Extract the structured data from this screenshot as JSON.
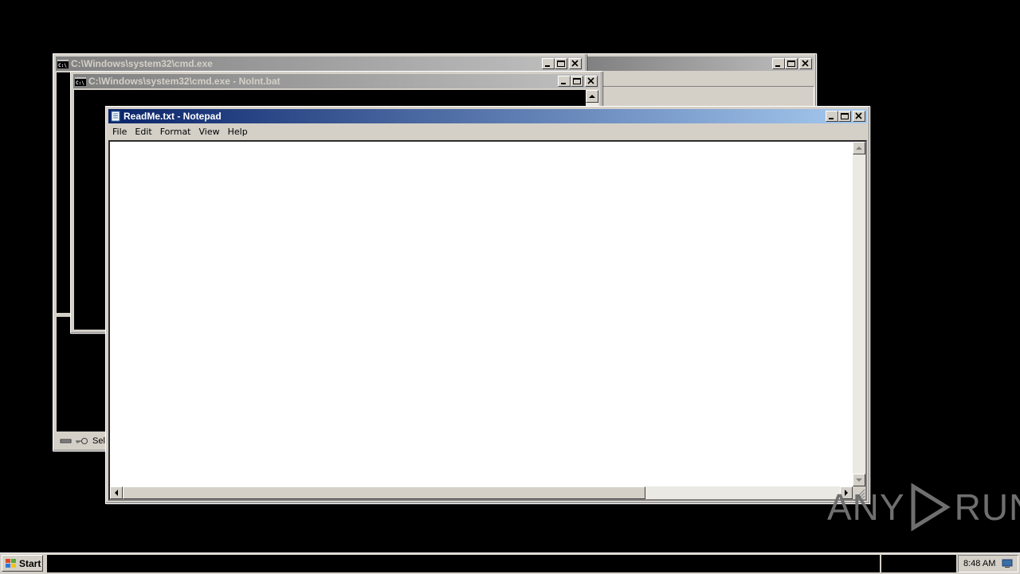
{
  "windows": {
    "cmd1": {
      "title": "C:\\Windows\\system32\\cmd.exe"
    },
    "cmd2": {
      "title": "C:\\Windows\\system32\\cmd.exe - NoInt.bat"
    },
    "notepad": {
      "title": "ReadMe.txt - Notepad",
      "menu": [
        "File",
        "Edit",
        "Format",
        "View",
        "Help"
      ],
      "content": ""
    }
  },
  "cmd_status": {
    "select_text": "Sele"
  },
  "taskbar": {
    "start_label": "Start",
    "clock": "8:48 AM"
  },
  "watermark": {
    "left": "ANY",
    "right": "RUN"
  },
  "icons": {
    "cmd": "console-icon",
    "notepad": "notepad-icon",
    "minimize": "minimize-icon",
    "maximize": "maximize-icon",
    "close": "close-icon",
    "start": "windows-logo-icon",
    "tray": "network-icon"
  },
  "colors": {
    "active_title_start": "#0a246a",
    "active_title_end": "#a6caf0",
    "inactive_title_start": "#808080",
    "inactive_title_end": "#c0c0c0",
    "face": "#d4d0c8"
  }
}
